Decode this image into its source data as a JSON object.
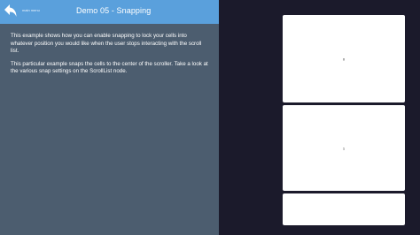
{
  "header": {
    "back_icon": "back-arrow-icon",
    "back_label": "main menu",
    "title": "Demo 05 - Snapping",
    "background_color": "#5aa0dc"
  },
  "description": {
    "paragraph_1": "This example shows how you can enable snapping to lock your cells into whatever position you would like when the user stops interacting with the scroll list.",
    "paragraph_2": "This particular example snaps the cells to the center of the scroller. Take a look at the various snap settings on the ScrollList node."
  },
  "scroll_list": {
    "background_color": "#1b1a2b",
    "cells": [
      {
        "label": "0"
      },
      {
        "label": "1"
      },
      {
        "label": ""
      }
    ]
  }
}
